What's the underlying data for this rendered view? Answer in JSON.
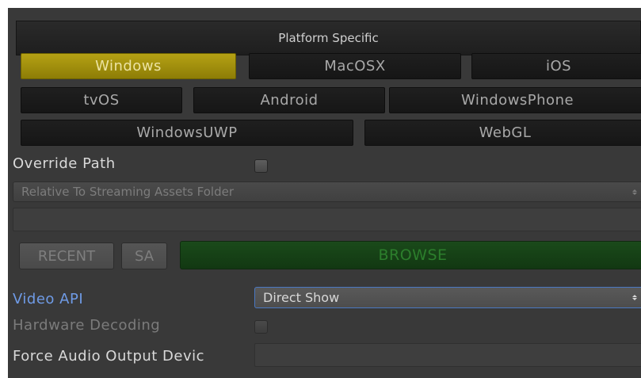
{
  "section": {
    "title": "Platform Specific"
  },
  "platforms": {
    "row1": [
      "Windows",
      "MacOSX",
      "iOS"
    ],
    "row2": [
      "tvOS",
      "Android",
      "WindowsPhone"
    ],
    "row3": [
      "WindowsUWP",
      "WebGL"
    ],
    "selected": "Windows"
  },
  "override_path": {
    "label": "Override Path",
    "checked": false
  },
  "path_mode": {
    "value": "Relative To Streaming Assets Folder",
    "path_value": ""
  },
  "actions": {
    "recent": "RECENT",
    "sa": "SA",
    "browse": "BROWSE"
  },
  "video_api": {
    "label": "Video API",
    "value": "Direct Show"
  },
  "hardware_decoding": {
    "label": "Hardware Decoding",
    "checked": false
  },
  "audio_device": {
    "label": "Force Audio Output Devic",
    "value": ""
  },
  "colors": {
    "panel_bg": "#393939",
    "selected_platform": "#a8950e",
    "browse_green": "#164016",
    "focus_blue": "#4a78c2",
    "label_blue": "#6f9be6"
  }
}
